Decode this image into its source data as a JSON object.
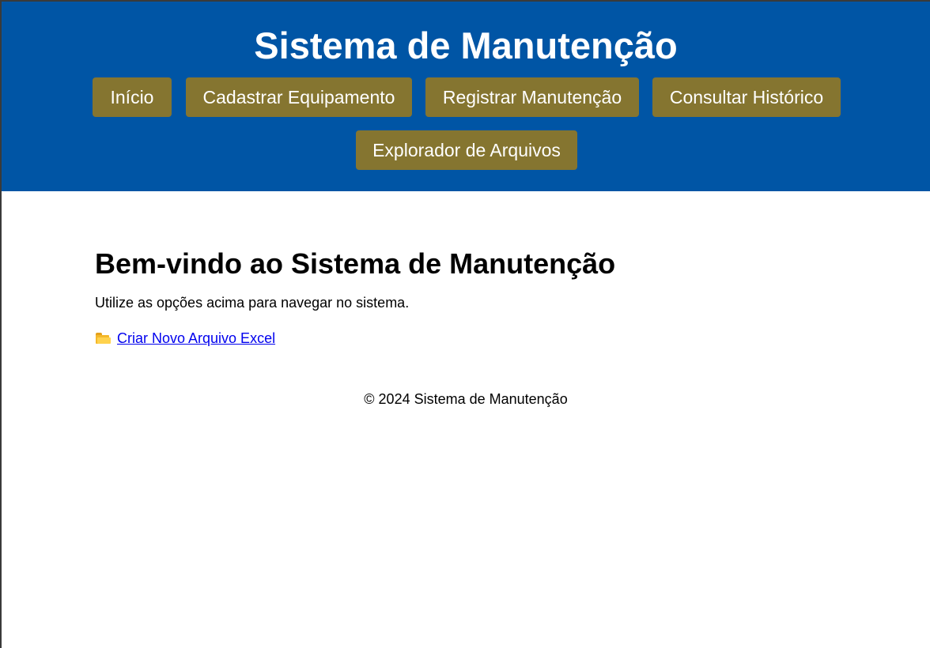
{
  "header": {
    "title": "Sistema de Manutenção",
    "background_color": "#0055a5",
    "nav": [
      {
        "id": "inicio",
        "label": "Início"
      },
      {
        "id": "cadastrar",
        "label": "Cadastrar Equipamento"
      },
      {
        "id": "registrar",
        "label": "Registrar Manutenção"
      },
      {
        "id": "consultar",
        "label": "Consultar Histórico"
      },
      {
        "id": "explorador",
        "label": "Explorador de Arquivos"
      }
    ],
    "nav_button_color": "#857530"
  },
  "main": {
    "heading": "Bem-vindo ao Sistema de Manutenção",
    "intro": "Utilize as opções acima para navegar no sistema.",
    "excel_link": {
      "icon": "folder-icon",
      "label": "Criar Novo Arquivo Excel"
    }
  },
  "footer": {
    "text": "© 2024 Sistema de Manutenção"
  }
}
